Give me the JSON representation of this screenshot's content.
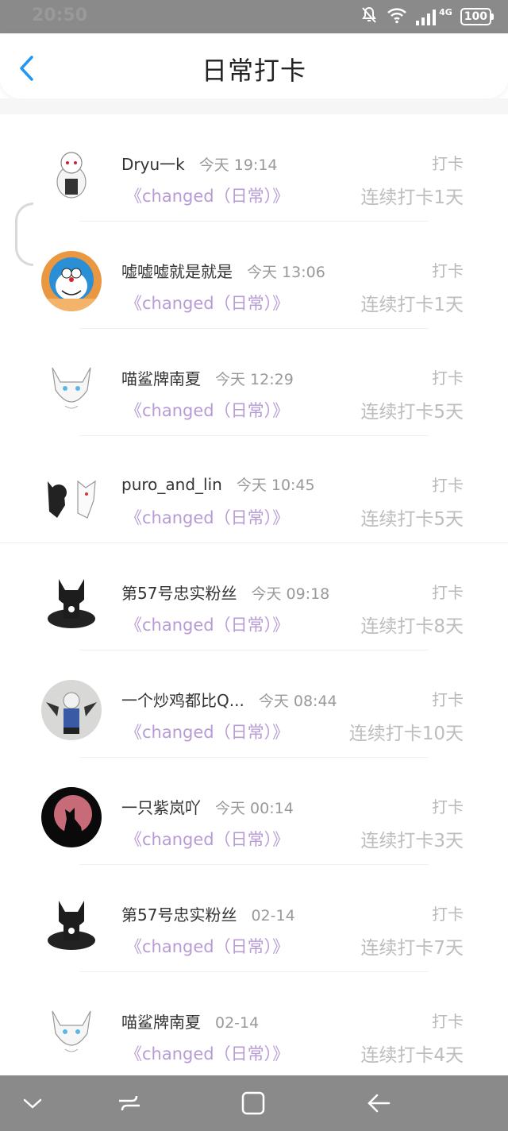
{
  "status_bar": {
    "time": "20:50",
    "network": "4G",
    "battery": "100",
    "icons": [
      "mute-bell-icon",
      "wifi-icon",
      "signal-icon",
      "battery-icon"
    ]
  },
  "header": {
    "title": "日常打卡",
    "back_icon": "chevron-left-icon",
    "accent_color": "#2196f3"
  },
  "colors": {
    "tag_color": "#b79bd6",
    "muted_text": "#999999",
    "faint_text": "#bdbdbd"
  },
  "list": [
    {
      "name": "Dryu一k",
      "time": "今天 19:14",
      "tag": "《changed（日常）》",
      "action": "打卡",
      "streak": "连续打卡1天"
    },
    {
      "name": "嘘嘘嘘就是就是",
      "time": "今天 13:06",
      "tag": "《changed（日常）》",
      "action": "打卡",
      "streak": "连续打卡1天"
    },
    {
      "name": "喵鲨牌南夏",
      "time": "今天 12:29",
      "tag": "《changed（日常）》",
      "action": "打卡",
      "streak": "连续打卡5天"
    },
    {
      "name": "puro_and_lin",
      "time": "今天 10:45",
      "tag": "《changed（日常）》",
      "action": "打卡",
      "streak": "连续打卡5天"
    },
    {
      "name": "第57号忠实粉丝",
      "time": "今天 09:18",
      "tag": "《changed（日常）》",
      "action": "打卡",
      "streak": "连续打卡8天"
    },
    {
      "name": "一个炒鸡都比Q...",
      "time": "今天 08:44",
      "tag": "《changed（日常）》",
      "action": "打卡",
      "streak": "连续打卡10天"
    },
    {
      "name": "一只紫岚吖",
      "time": "今天 00:14",
      "tag": "《changed（日常）》",
      "action": "打卡",
      "streak": "连续打卡3天"
    },
    {
      "name": "第57号忠实粉丝",
      "time": "02-14",
      "tag": "《changed（日常）》",
      "action": "打卡",
      "streak": "连续打卡7天"
    },
    {
      "name": "喵鲨牌南夏",
      "time": "02-14",
      "tag": "《changed（日常）》",
      "action": "打卡",
      "streak": "连续打卡4天"
    }
  ],
  "nav_bar": {
    "icons": [
      "chevron-down-icon",
      "recent-apps-icon",
      "home-icon",
      "back-arrow-icon"
    ]
  }
}
